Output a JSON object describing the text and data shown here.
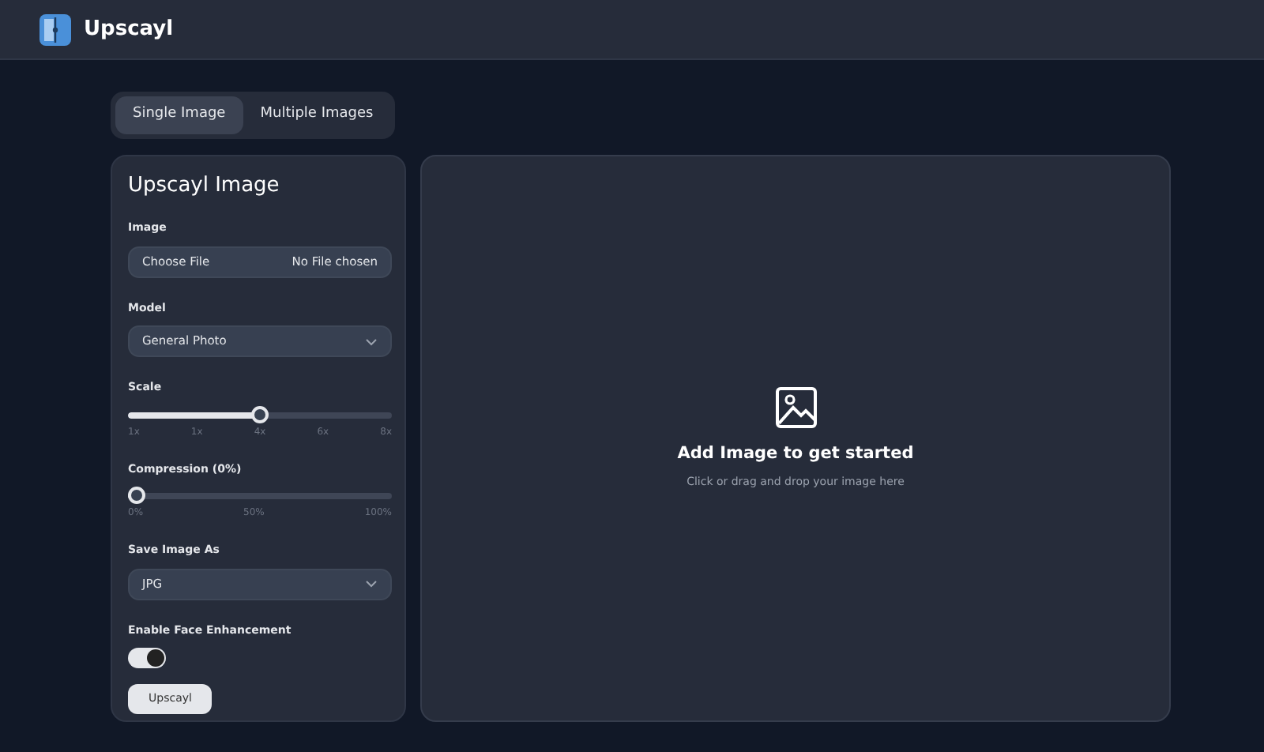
{
  "app": {
    "title": "Upscayl"
  },
  "tabs": [
    {
      "label": "Single Image",
      "selected": true
    },
    {
      "label": "Multiple Images",
      "selected": false
    }
  ],
  "panel": {
    "title": "Upscayl Image",
    "image": {
      "label": "Image",
      "button": "Choose File",
      "status": "No File chosen"
    },
    "model": {
      "label": "Model",
      "value": "General Photo"
    },
    "scale": {
      "label": "Scale",
      "level": 0.5,
      "ticks": [
        "1x",
        "1x",
        "4x",
        "6x",
        "8x"
      ]
    },
    "compression": {
      "label": "Compression (0%)",
      "level": 0,
      "ticks": [
        "0%",
        "50%",
        "100%"
      ]
    },
    "format": {
      "label": "Save Image As",
      "value": "JPG"
    },
    "face": {
      "label": "Enable Face Enhancement",
      "on": true
    },
    "button": "Upscayl"
  },
  "dropzone": {
    "title": "Add Image to get started",
    "hint": "Click or drag and drop your image here"
  }
}
